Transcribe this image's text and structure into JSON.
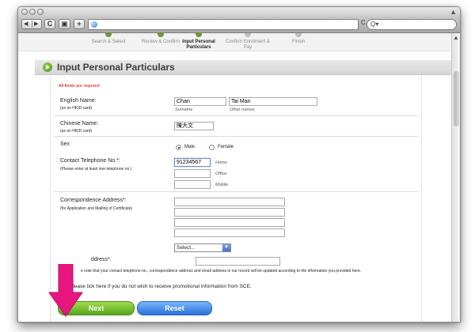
{
  "browser": {
    "nav_back": "◀",
    "nav_forward": "▶",
    "reload_label": "C",
    "bookmark_icon": "▣",
    "add_label": "+",
    "url_value": "",
    "search_placeholder": "Q▾",
    "url_reload": "C"
  },
  "steps": [
    {
      "label": "Search & Select",
      "state": "done"
    },
    {
      "label": "Review & Confirm",
      "state": "done"
    },
    {
      "label": "Input Personal Particulars",
      "state": "active"
    },
    {
      "label": "Confirm Enrolment & Pay",
      "state": "pending"
    },
    {
      "label": "Finish",
      "state": "pending"
    }
  ],
  "page_title": "Input Personal Particulars",
  "form": {
    "required_note": "All fields are required",
    "english_name": {
      "label": "English Name:",
      "sublabel": "(as on HKID card)",
      "surname_value": "Chan",
      "surname_hint": "Surname",
      "other_value": "Tai Man",
      "other_hint": "Other names"
    },
    "chinese_name": {
      "label": "Chinese Name:",
      "sublabel": "(as on HKID card)",
      "value": "陳大文"
    },
    "sex": {
      "label": "Sex",
      "options": [
        "Male",
        "Female"
      ],
      "selected": "Male"
    },
    "telephone": {
      "label": "Contact Telephone No.*:",
      "sublabel": "(Please enter at least one telephone no.)",
      "home_value": "91234567",
      "home_hint": "Home",
      "office_hint": "Office",
      "mobile_hint": "Mobile"
    },
    "address": {
      "label": "Correspondence Address*:",
      "sublabel": "(for Application and Mailing of Certificate)",
      "select_value": "Select..."
    },
    "email": {
      "label_fragment": "ddress*:"
    },
    "update_note": "e note that your contact telephone no., correspondence address and email address in our record will be updated according to the information you provided here.",
    "promo_checkbox_label": "Please tick here if you do not wish to receive promotional information from SCE.",
    "next_label": "Next",
    "reset_label": "Reset"
  },
  "colors": {
    "next_button": "#6bb82a",
    "reset_button": "#3f86e8",
    "indicator_arrow": "#e8157f",
    "required_text": "#e00000"
  }
}
